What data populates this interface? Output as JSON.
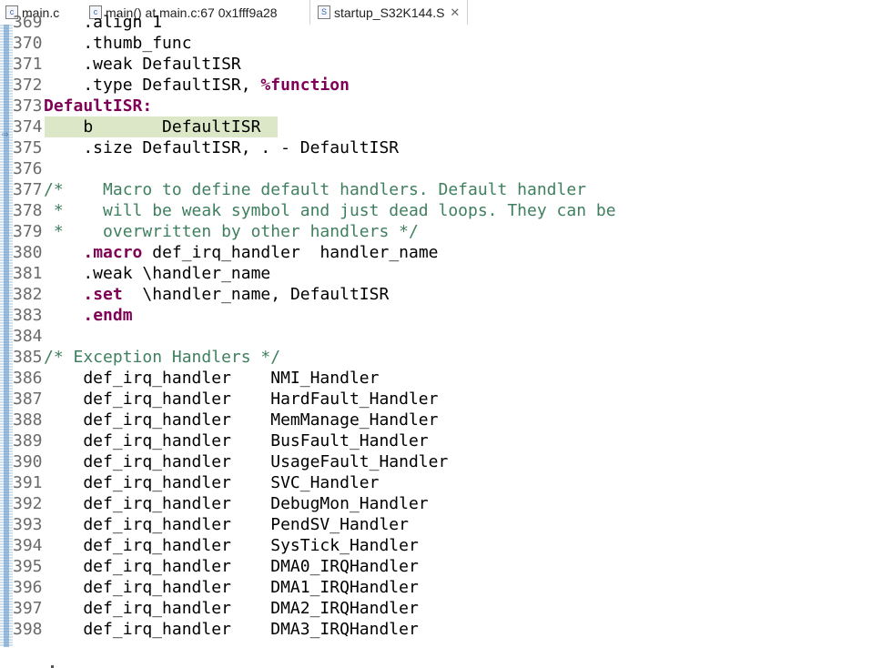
{
  "tabs": [
    {
      "label": "main.c",
      "icon": "c-file-icon",
      "active": false
    },
    {
      "label": "main() at main.c:67 0x1fff9a28",
      "icon": "c-file-icon",
      "active": false
    },
    {
      "label": "startup_S32K144.S",
      "icon": "asm-file-icon",
      "active": true,
      "close": "✕"
    }
  ],
  "editor": {
    "lines": [
      {
        "num": "369",
        "text": "    .align 1"
      },
      {
        "num": "370",
        "text": "    .thumb_func"
      },
      {
        "num": "371",
        "text": "    .weak DefaultISR"
      },
      {
        "num": "372",
        "pre": "    .type DefaultISR, ",
        "kw": "%function"
      },
      {
        "num": "373",
        "label": "DefaultISR:"
      },
      {
        "num": "374",
        "text": "    b       DefaultISR",
        "current": true
      },
      {
        "num": "375",
        "text": "    .size DefaultISR, . - DefaultISR"
      },
      {
        "num": "376",
        "text": ""
      },
      {
        "num": "377",
        "comment": "/*    Macro to define default handlers. Default handler"
      },
      {
        "num": "378",
        "comment": " *    will be weak symbol and just dead loops. They can be"
      },
      {
        "num": "379",
        "comment": " *    overwritten by other handlers */"
      },
      {
        "num": "380",
        "pre": "    ",
        "kw": ".macro",
        "post": " def_irq_handler  handler_name"
      },
      {
        "num": "381",
        "text": "    .weak \\handler_name"
      },
      {
        "num": "382",
        "pre": "    ",
        "kw": ".set",
        "post": "  \\handler_name, DefaultISR"
      },
      {
        "num": "383",
        "pre": "    ",
        "kw": ".endm"
      },
      {
        "num": "384",
        "text": ""
      },
      {
        "num": "385",
        "comment": "/* Exception Handlers */"
      },
      {
        "num": "386",
        "text": "    def_irq_handler    NMI_Handler"
      },
      {
        "num": "387",
        "text": "    def_irq_handler    HardFault_Handler"
      },
      {
        "num": "388",
        "text": "    def_irq_handler    MemManage_Handler"
      },
      {
        "num": "389",
        "text": "    def_irq_handler    BusFault_Handler"
      },
      {
        "num": "390",
        "text": "    def_irq_handler    UsageFault_Handler"
      },
      {
        "num": "391",
        "text": "    def_irq_handler    SVC_Handler"
      },
      {
        "num": "392",
        "text": "    def_irq_handler    DebugMon_Handler"
      },
      {
        "num": "393",
        "text": "    def_irq_handler    PendSV_Handler"
      },
      {
        "num": "394",
        "text": "    def_irq_handler    SysTick_Handler"
      },
      {
        "num": "395",
        "text": "    def_irq_handler    DMA0_IRQHandler"
      },
      {
        "num": "396",
        "text": "    def_irq_handler    DMA1_IRQHandler"
      },
      {
        "num": "397",
        "text": "    def_irq_handler    DMA2_IRQHandler"
      },
      {
        "num": "398",
        "text": "    def_irq_handler    DMA3_IRQHandler"
      }
    ]
  },
  "colors": {
    "keyword": "#7f0055",
    "comment": "#3f7f5f",
    "current_line": "#dbe7c6"
  }
}
